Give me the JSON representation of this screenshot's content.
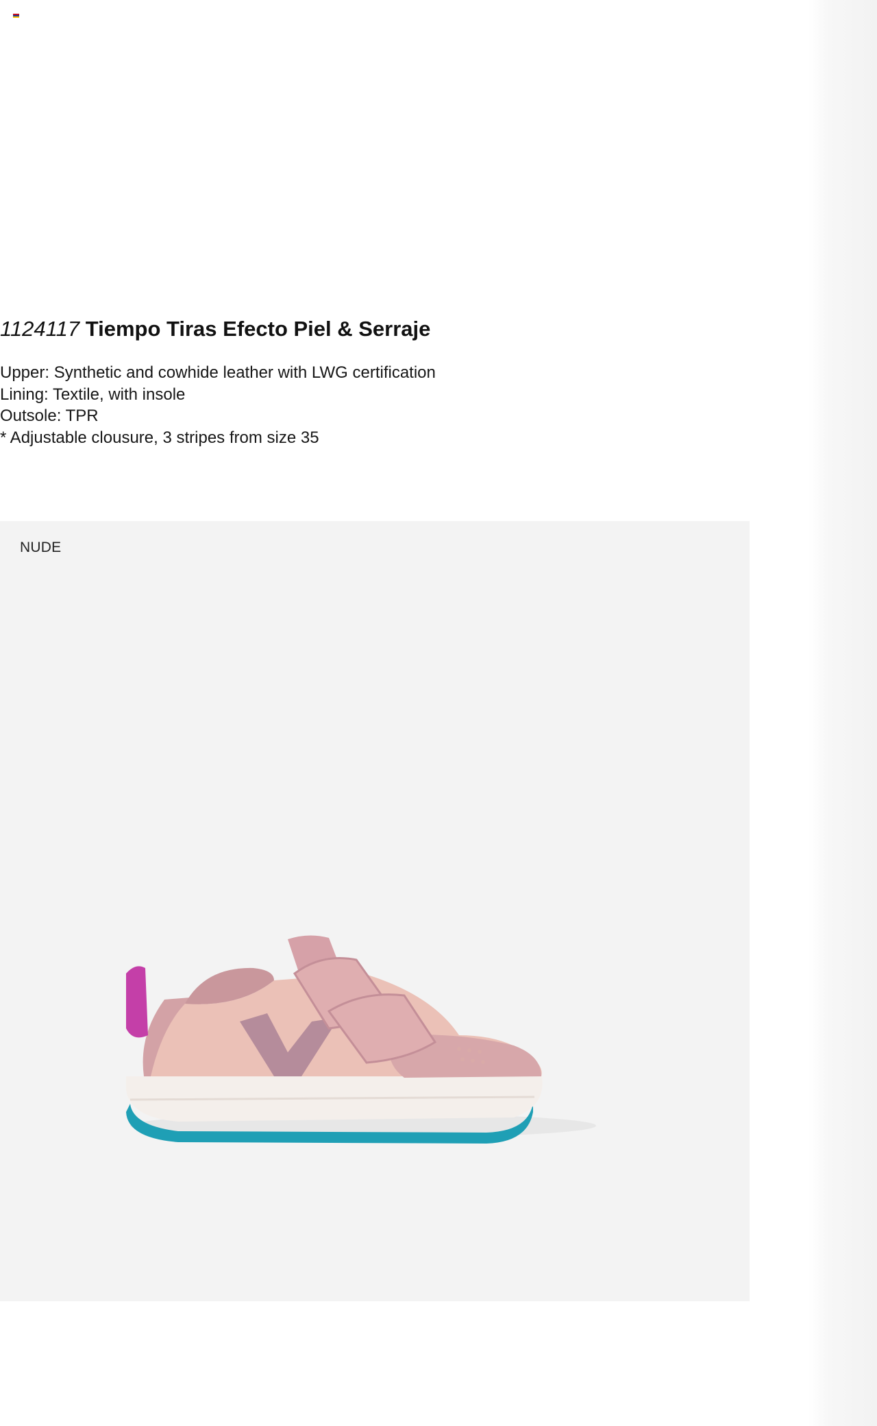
{
  "header": {
    "flag_icon": "flag-icon",
    "flag_colors": [
      "#c60b1e",
      "#1f3a93",
      "#ffc400"
    ]
  },
  "product": {
    "reference": "1124117",
    "name": "Tiempo Tiras Efecto Piel & Serraje",
    "specs": [
      "Upper: Synthetic and cowhide leather with LWG certification",
      "Lining: Textile, with insole",
      "Outsole: TPR",
      "* Adjustable clousure, 3 stripes from size 35"
    ]
  },
  "variant": {
    "color_label": "NUDE",
    "panel_bg": "#f3f3f3",
    "shoe_colors": {
      "upper": "#e8b8b0",
      "suede": "#d6a5a8",
      "v_logo": "#b58c9b",
      "heel_tab": "#c43fa8",
      "midsole": "#f4efeb",
      "outsole": "#1f9fb5"
    }
  }
}
